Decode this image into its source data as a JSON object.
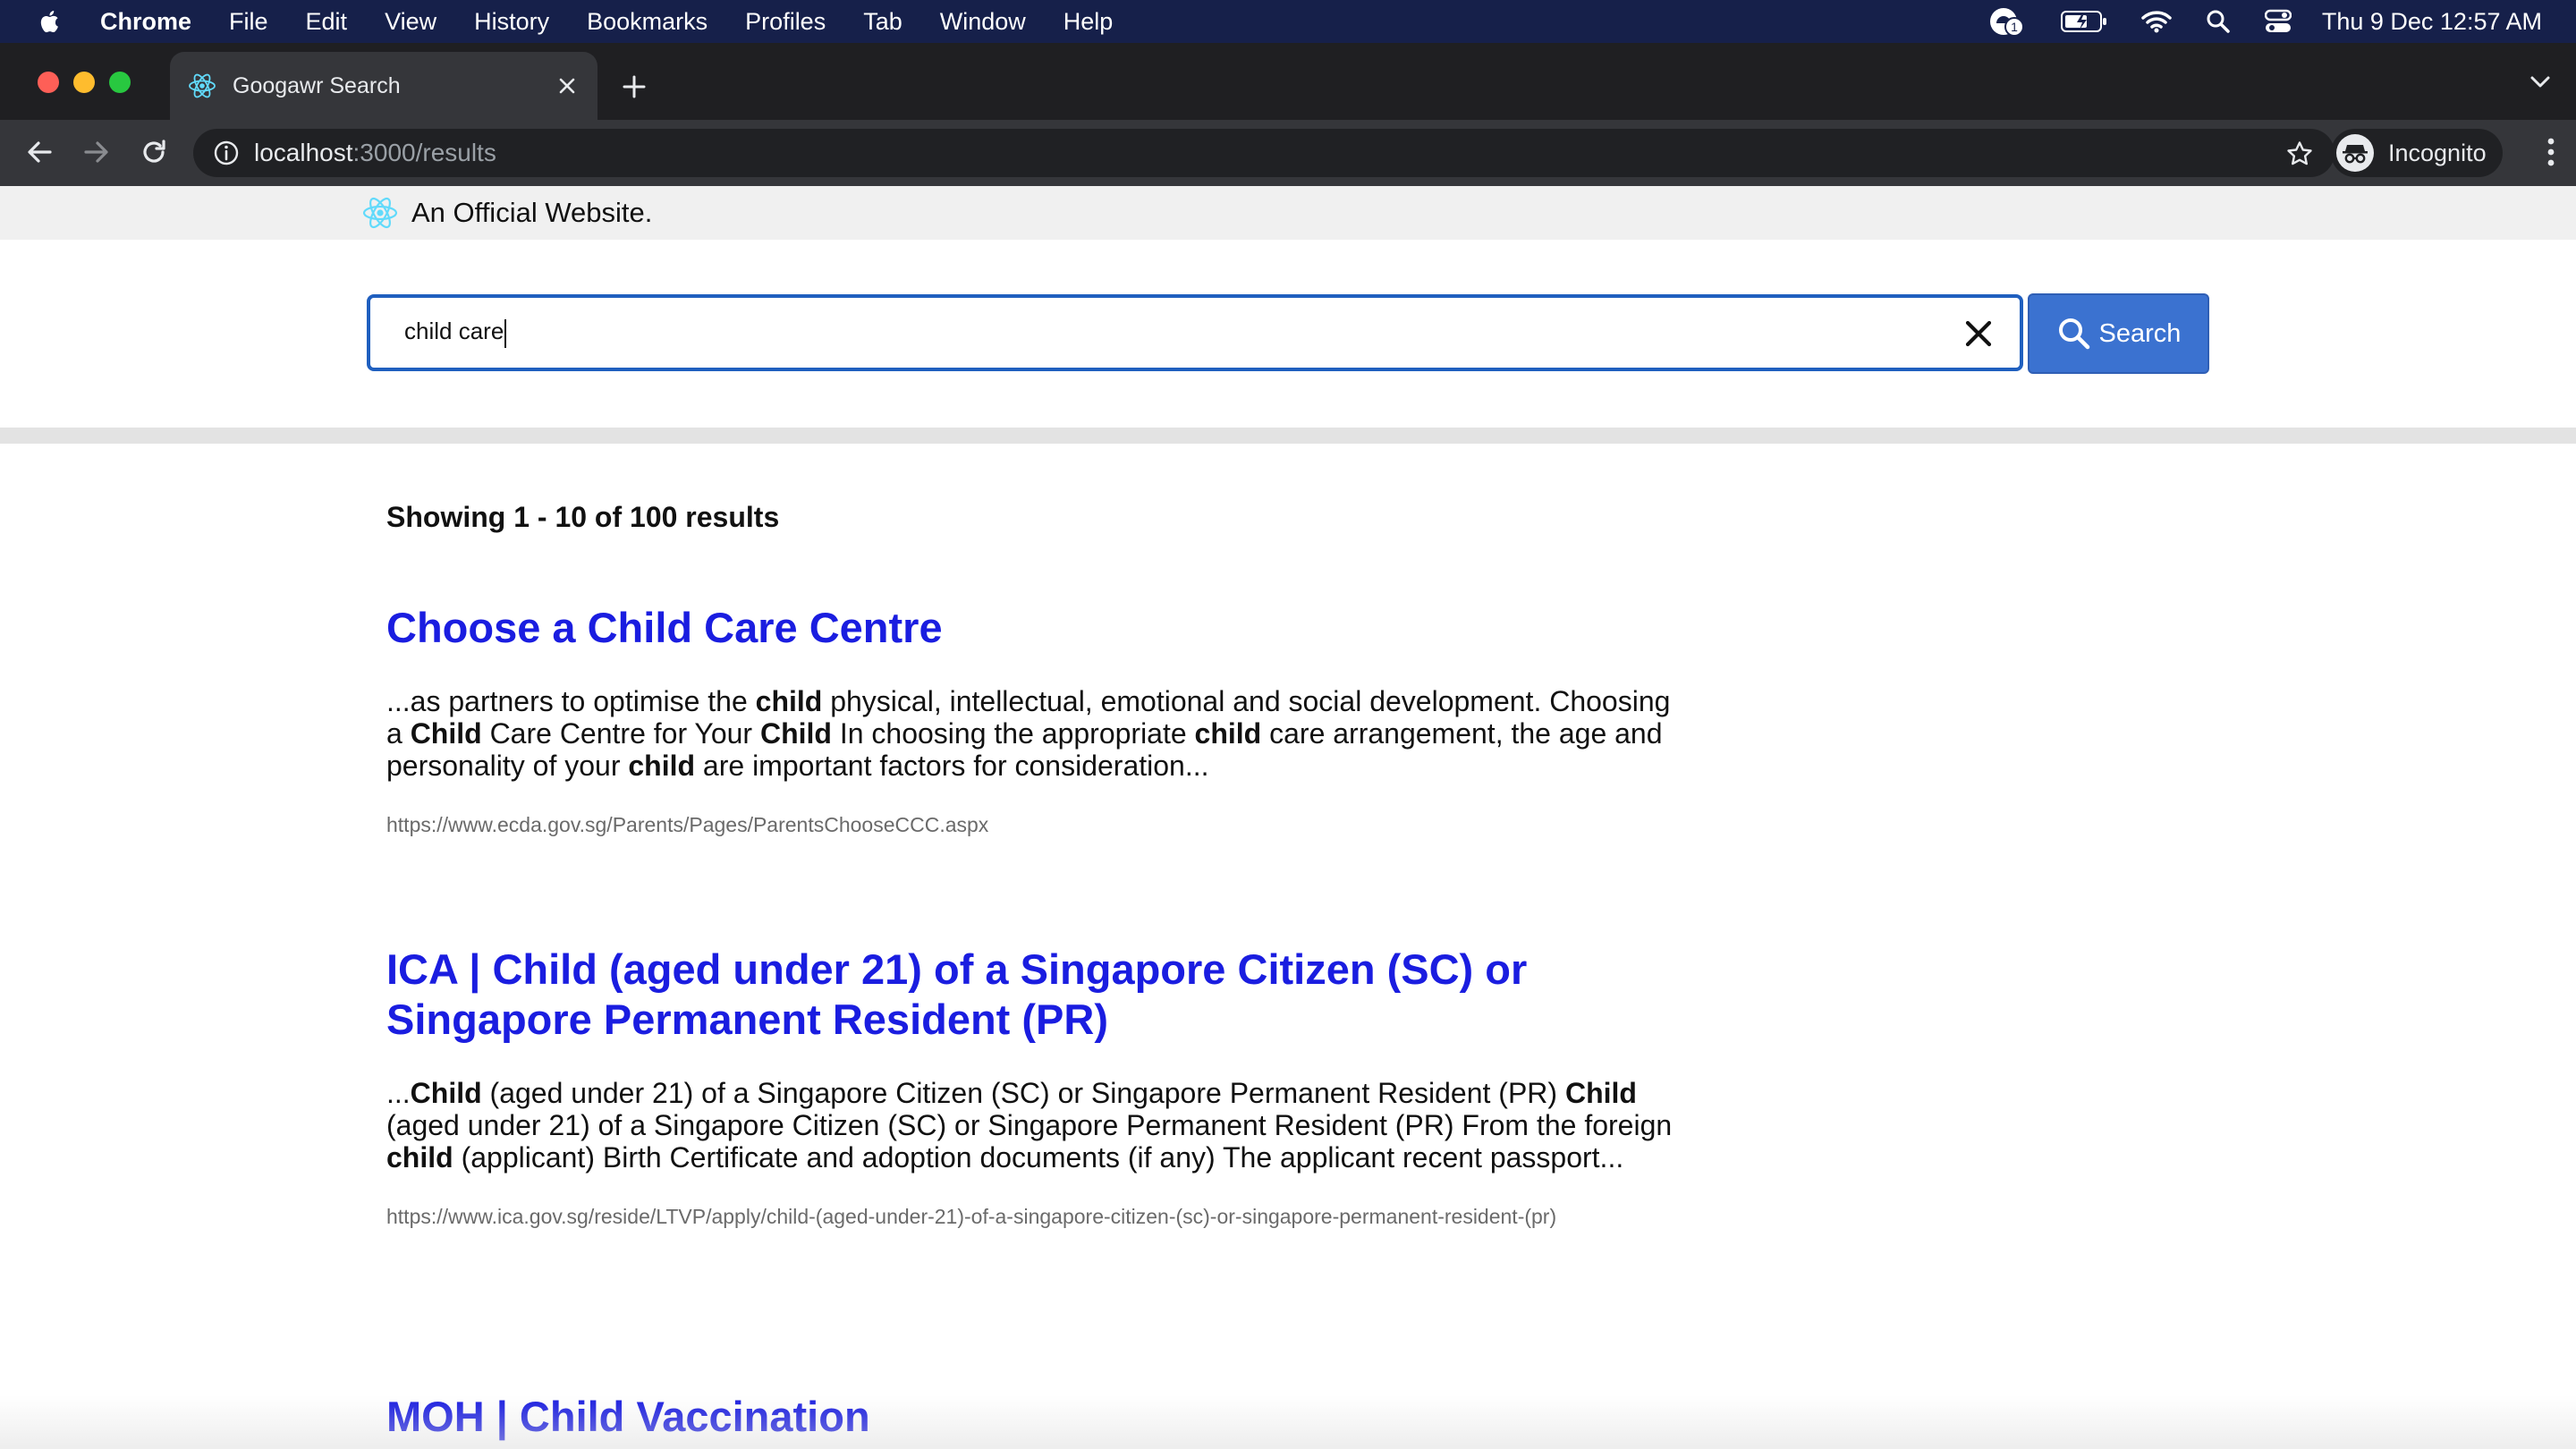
{
  "menubar": {
    "app": "Chrome",
    "items": [
      "File",
      "Edit",
      "View",
      "History",
      "Bookmarks",
      "Profiles",
      "Tab",
      "Window",
      "Help"
    ],
    "notification_badge": "1",
    "clock": "Thu 9 Dec  12:57 AM"
  },
  "browser": {
    "tab_title": "Googawr Search",
    "url_host": "localhost",
    "url_path": ":3000/results",
    "profile_label": "Incognito"
  },
  "page": {
    "banner_text": "An Official Website.",
    "search": {
      "value": "child care",
      "button_label": "Search"
    },
    "results_summary": "Showing 1 - 10 of 100 results",
    "results": [
      {
        "title": "Choose a Child Care Centre",
        "snippet_html": "...as partners to optimise the <b>child</b> physical, intellectual, emotional and social development. Choosing a <b>Child</b> Care Centre for Your <b>Child</b> In choosing the appropriate <b>child</b> care arrangement, the age and personality of your <b>child</b> are important factors for consideration...",
        "url": "https://www.ecda.gov.sg/Parents/Pages/ParentsChooseCCC.aspx"
      },
      {
        "title": "ICA | Child (aged under 21) of a Singapore Citizen (SC) or Singapore Permanent Resident (PR)",
        "snippet_html": "...<b>Child</b> (aged under 21) of a Singapore Citizen (SC) or Singapore Permanent Resident (PR) <b>Child</b> (aged under 21) of a Singapore Citizen (SC) or Singapore Permanent Resident (PR) From the foreign <b>child</b> (applicant) Birth Certificate and adoption documents (if any) The applicant recent passport...",
        "url": "https://www.ica.gov.sg/reside/LTVP/apply/child-(aged-under-21)-of-a-singapore-citizen-(sc)-or-singapore-permanent-resident-(pr)"
      },
      {
        "title": "MOH | Child Vaccination"
      }
    ]
  },
  "colors": {
    "menubar_bg": "#16204a",
    "chrome_dark": "#35363a",
    "result_link": "#1a1de0",
    "search_button": "#3b72d0",
    "search_border": "#1f5fbf"
  }
}
